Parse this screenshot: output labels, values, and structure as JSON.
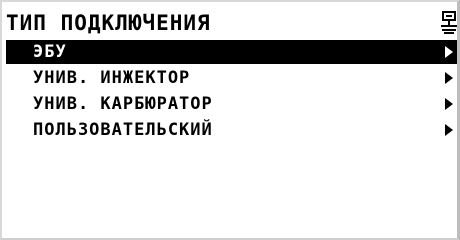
{
  "header": {
    "title": "ТИП ПОДКЛЮЧЕНИЯ",
    "icon": "connection-icon"
  },
  "menu": {
    "selected_index": 0,
    "items": [
      {
        "label": "ЭБУ"
      },
      {
        "label": "УНИВ. ИНЖЕКТОР"
      },
      {
        "label": "УНИВ. КАРБЮРАТОР"
      },
      {
        "label": "ПОЛЬЗОВАТЕЛЬСКИЙ"
      }
    ]
  },
  "colors": {
    "background": "#ffffff",
    "foreground": "#000000",
    "selection_bg": "#000000",
    "selection_fg": "#ffffff"
  }
}
